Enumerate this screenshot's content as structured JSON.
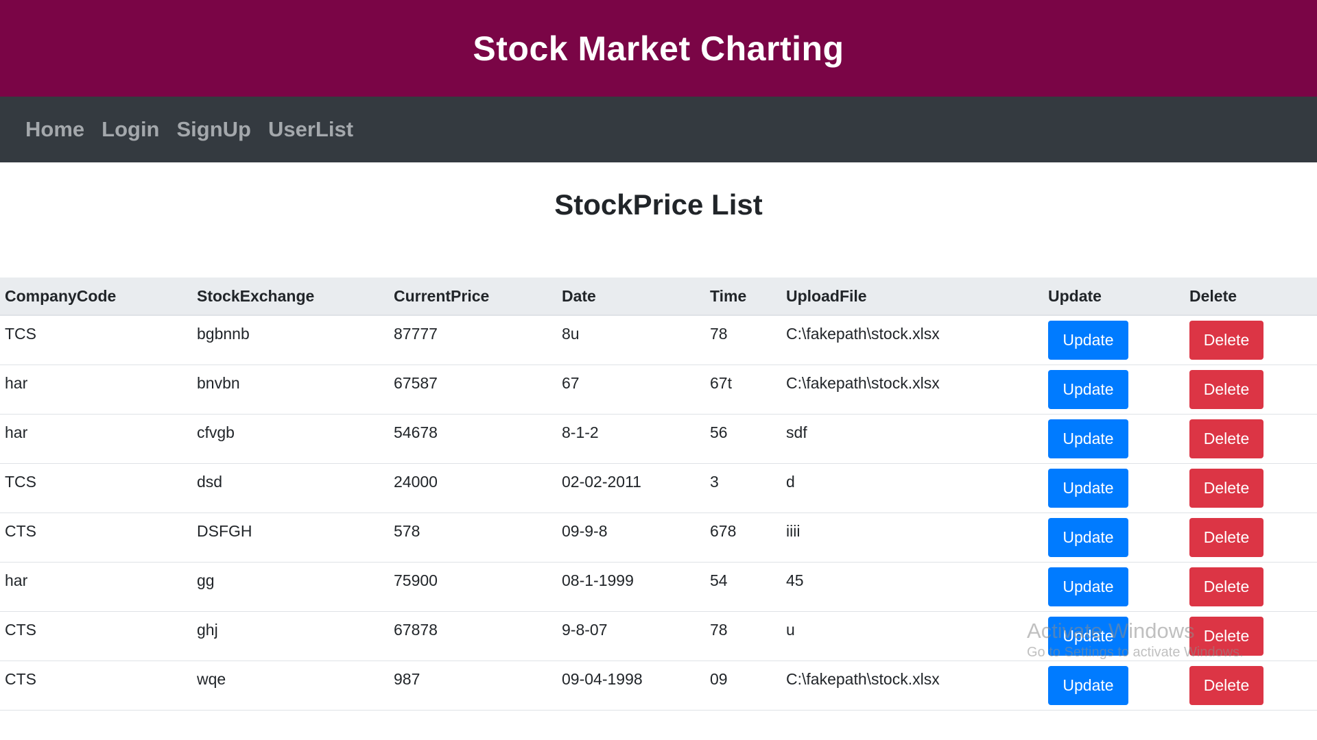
{
  "app": {
    "title": "Stock Market Charting"
  },
  "nav": {
    "items": [
      "Home",
      "Login",
      "SignUp",
      "UserList"
    ]
  },
  "page": {
    "title": "StockPrice List"
  },
  "table": {
    "columns": [
      "CompanyCode",
      "StockExchange",
      "CurrentPrice",
      "Date",
      "Time",
      "UploadFile",
      "Update",
      "Delete"
    ],
    "update_label": "Update",
    "delete_label": "Delete",
    "rows": [
      [
        "TCS",
        "bgbnnb",
        "87777",
        "8u",
        "78",
        "C:\\fakepath\\stock.xlsx"
      ],
      [
        "har",
        "bnvbn",
        "67587",
        "67",
        "67t",
        "C:\\fakepath\\stock.xlsx"
      ],
      [
        "har",
        "cfvgb",
        "54678",
        "8-1-2",
        "56",
        "sdf"
      ],
      [
        "TCS",
        "dsd",
        "24000",
        "02-02-2011",
        "3",
        "d"
      ],
      [
        "CTS",
        "DSFGH",
        "578",
        "09-9-8",
        "678",
        "iiii"
      ],
      [
        "har",
        "gg",
        "75900",
        "08-1-1999",
        "54",
        "45"
      ],
      [
        "CTS",
        "ghj",
        "67878",
        "9-8-07",
        "78",
        "u"
      ],
      [
        "CTS",
        "wqe",
        "987",
        "09-04-1998",
        "09",
        "C:\\fakepath\\stock.xlsx"
      ]
    ]
  },
  "watermark": {
    "title": "Activate Windows",
    "subtitle": "Go to Settings to activate Windows."
  },
  "colors": {
    "banner": "#7a0546",
    "navbar": "#343a40",
    "update_button": "#007bff",
    "delete_button": "#dc3545"
  }
}
